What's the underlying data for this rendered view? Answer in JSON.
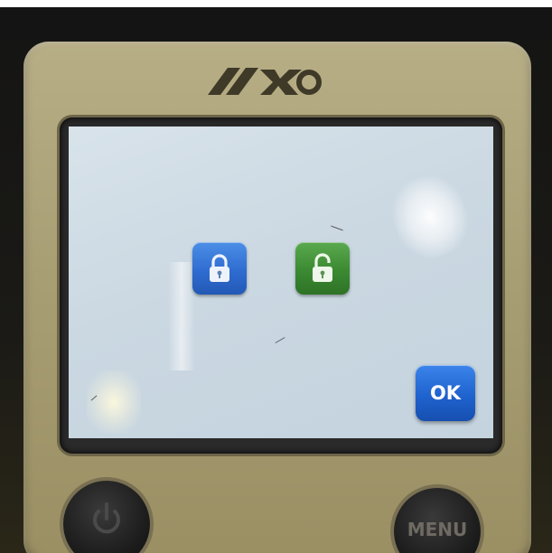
{
  "device": {
    "brand_logo": "AKO"
  },
  "screen": {
    "lock_icons": [
      {
        "icon": "padlock-closed",
        "color": "#2f6cd1"
      },
      {
        "icon": "padlock-open",
        "color": "#3b8a32"
      }
    ],
    "ok_button_label": "OK"
  },
  "hardware_buttons": {
    "power_icon": "power-icon",
    "menu_label": "MENU"
  }
}
